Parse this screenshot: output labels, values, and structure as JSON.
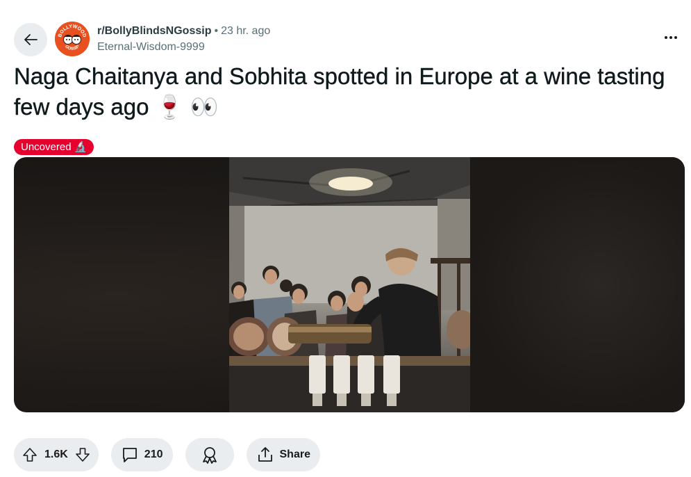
{
  "post": {
    "subreddit": "r/BollyBlindsNGossip",
    "separator": "•",
    "time": "23 hr. ago",
    "author": "Eternal-Wisdom-9999",
    "title": "Naga Chaitanya and Sobhita spotted in Europe at a wine tasting few days ago 🍷 👀",
    "flair": {
      "text": "Uncovered 🔬",
      "color": "#e6002e"
    },
    "avatar_text": {
      "top": "BOLLYWOOD",
      "bottom": "GOSSIP"
    }
  },
  "actions": {
    "votes": "1.6K",
    "comments": "210",
    "share_label": "Share"
  },
  "icons": [
    "back-arrow-icon",
    "more-options-icon",
    "upvote-icon",
    "downvote-icon",
    "comment-icon",
    "award-icon",
    "share-icon"
  ]
}
